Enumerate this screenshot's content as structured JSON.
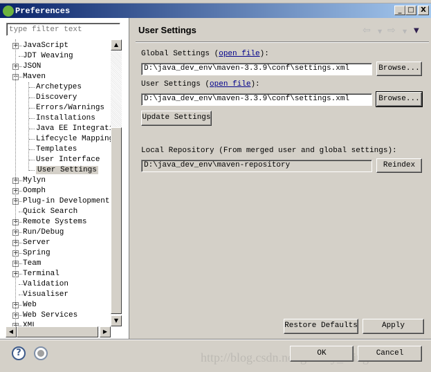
{
  "window": {
    "title": "Preferences",
    "minimize": "_",
    "maximize": "□",
    "close": "X"
  },
  "filter": {
    "placeholder": "type filter text"
  },
  "tree": [
    {
      "label": "JavaScript",
      "level": 0,
      "expander": "+"
    },
    {
      "label": "JDT Weaving",
      "level": 0,
      "expander": ""
    },
    {
      "label": "JSON",
      "level": 0,
      "expander": "+"
    },
    {
      "label": "Maven",
      "level": 0,
      "expander": "-"
    },
    {
      "label": "Archetypes",
      "level": 1,
      "expander": ""
    },
    {
      "label": "Discovery",
      "level": 1,
      "expander": ""
    },
    {
      "label": "Errors/Warnings",
      "level": 1,
      "expander": ""
    },
    {
      "label": "Installations",
      "level": 1,
      "expander": ""
    },
    {
      "label": "Java EE Integratio",
      "level": 1,
      "expander": ""
    },
    {
      "label": "Lifecycle Mappings",
      "level": 1,
      "expander": ""
    },
    {
      "label": "Templates",
      "level": 1,
      "expander": ""
    },
    {
      "label": "User Interface",
      "level": 1,
      "expander": ""
    },
    {
      "label": "User Settings",
      "level": 1,
      "expander": "",
      "selected": true
    },
    {
      "label": "Mylyn",
      "level": 0,
      "expander": "+"
    },
    {
      "label": "Oomph",
      "level": 0,
      "expander": "+"
    },
    {
      "label": "Plug-in Development",
      "level": 0,
      "expander": "+"
    },
    {
      "label": "Quick Search",
      "level": 0,
      "expander": ""
    },
    {
      "label": "Remote Systems",
      "level": 0,
      "expander": "+"
    },
    {
      "label": "Run/Debug",
      "level": 0,
      "expander": "+"
    },
    {
      "label": "Server",
      "level": 0,
      "expander": "+"
    },
    {
      "label": "Spring",
      "level": 0,
      "expander": "+"
    },
    {
      "label": "Team",
      "level": 0,
      "expander": "+"
    },
    {
      "label": "Terminal",
      "level": 0,
      "expander": "+"
    },
    {
      "label": "Validation",
      "level": 0,
      "expander": ""
    },
    {
      "label": "Visualiser",
      "level": 0,
      "expander": ""
    },
    {
      "label": "Web",
      "level": 0,
      "expander": "+"
    },
    {
      "label": "Web Services",
      "level": 0,
      "expander": "+"
    },
    {
      "label": "XML",
      "level": 0,
      "expander": "+"
    }
  ],
  "page": {
    "title": "User Settings",
    "global_label": "Global Settings (",
    "global_link": "open file",
    "global_suffix": "):",
    "global_value": "D:\\java_dev_env\\maven-3.3.9\\conf\\settings.xml",
    "user_label": "User Settings (",
    "user_link": "open file",
    "user_suffix": "):",
    "user_value": "D:\\java_dev_env\\maven-3.3.9\\conf\\settings.xml",
    "browse": "Browse...",
    "update": "Update Settings",
    "local_label": "Local Repository (From merged user and global settings):",
    "local_value": "D:\\java_dev_env\\maven-repository",
    "reindex": "Reindex",
    "restore": "Restore Defaults",
    "apply": "Apply"
  },
  "footer": {
    "ok": "OK",
    "cancel": "Cancel",
    "help": "?"
  },
  "watermark": "http://blog.csdn.net/gleamy_ming"
}
